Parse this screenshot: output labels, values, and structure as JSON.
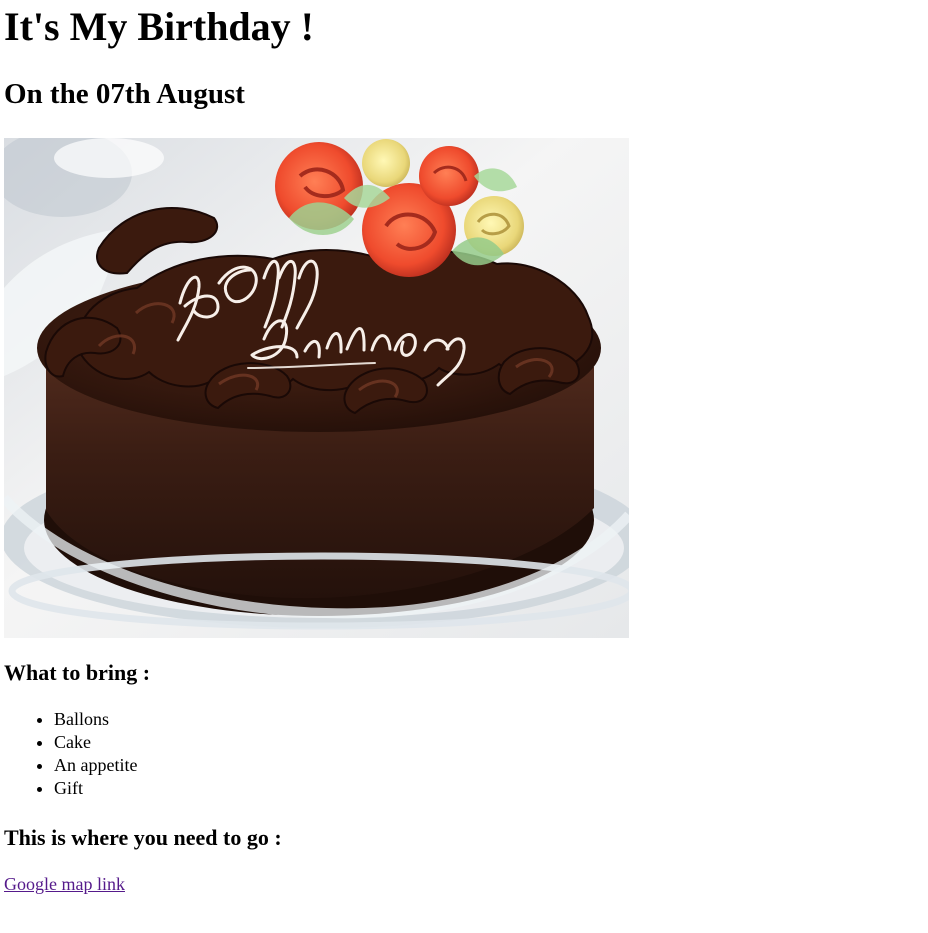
{
  "page": {
    "title": "It's My Birthday !",
    "subtitle": "On the 07th August"
  },
  "image": {
    "alt": "chocolate birthday cake with roses and Happy Birthday writing",
    "cake_text_line1": "Happy",
    "cake_text_line2": "Birthday"
  },
  "bring": {
    "heading": "What to bring :",
    "items": [
      "Ballons",
      "Cake",
      "An appetite",
      "Gift"
    ]
  },
  "directions": {
    "heading": "This is where you need to go :",
    "link_label": "Google map link"
  },
  "colors": {
    "background": "#ffffff",
    "text": "#000000",
    "visited_link": "#551a8b"
  }
}
